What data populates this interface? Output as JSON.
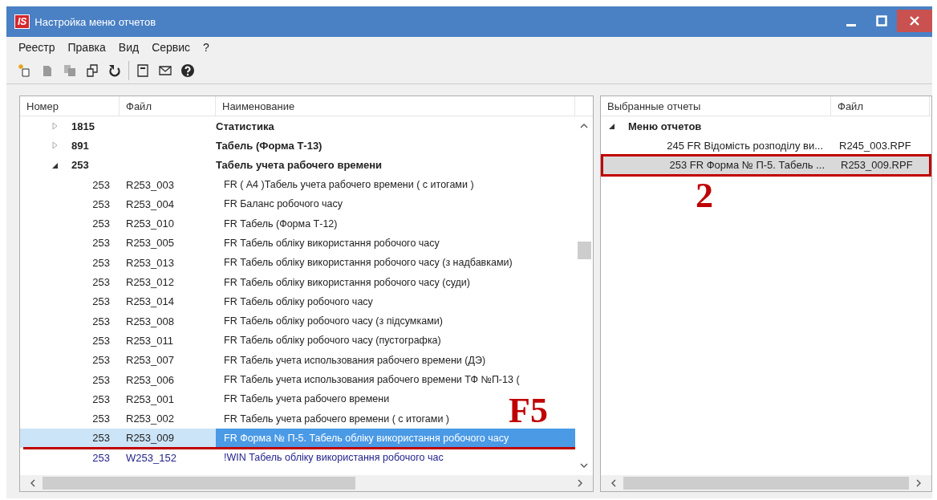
{
  "window": {
    "logo": "IS",
    "title": "Настройка меню отчетов"
  },
  "menu": [
    "Реестр",
    "Правка",
    "Вид",
    "Сервис",
    "?"
  ],
  "toolbar": [
    {
      "kind": "new",
      "disabled": false
    },
    {
      "kind": "page",
      "disabled": true
    },
    {
      "kind": "pages",
      "disabled": true
    },
    {
      "kind": "copy",
      "disabled": false
    },
    {
      "kind": "refresh",
      "disabled": false
    },
    {
      "kind": "separator"
    },
    {
      "kind": "form",
      "disabled": false
    },
    {
      "kind": "mail",
      "disabled": false
    },
    {
      "kind": "help",
      "disabled": false
    }
  ],
  "report_tree": {
    "columns": [
      "Номер",
      "Файл",
      "Наименование"
    ],
    "groups": [
      {
        "number": "1815",
        "name": "Статистика",
        "expanded": false,
        "selected": false
      },
      {
        "number": "891",
        "name": "Табель (Форма Т-13)",
        "expanded": false,
        "selected": false
      },
      {
        "number": "253",
        "name": "Табель учета рабочего времени",
        "expanded": true,
        "selected": false,
        "children": [
          {
            "number": "253",
            "file": "R253_003",
            "name": "FR ( А4 )Табель учета рабочего времени ( с итогами )",
            "kind": "report",
            "selected": false
          },
          {
            "number": "253",
            "file": "R253_004",
            "name": "FR Баланс робочого часу",
            "kind": "report",
            "selected": false
          },
          {
            "number": "253",
            "file": "R253_010",
            "name": "FR Табель (Форма Т-12)",
            "kind": "report",
            "selected": false
          },
          {
            "number": "253",
            "file": "R253_005",
            "name": "FR Табель обліку використання робочого часу",
            "kind": "report",
            "selected": false
          },
          {
            "number": "253",
            "file": "R253_013",
            "name": "FR Табель обліку використання робочого часу (з надбавками)",
            "kind": "report",
            "selected": false
          },
          {
            "number": "253",
            "file": "R253_012",
            "name": "FR Табель обліку використання робочого часу (суди)",
            "kind": "report",
            "selected": false
          },
          {
            "number": "253",
            "file": "R253_014",
            "name": "FR Табель обліку робочого часу",
            "kind": "report",
            "selected": false
          },
          {
            "number": "253",
            "file": "R253_008",
            "name": "FR Табель обліку робочого часу (з підсумками)",
            "kind": "report",
            "selected": false
          },
          {
            "number": "253",
            "file": "R253_011",
            "name": "FR Табель обліку робочого часу (пустографка)",
            "kind": "report",
            "selected": false
          },
          {
            "number": "253",
            "file": "R253_007",
            "name": "FR Табель учета использования рабочего времени (ДЭ)",
            "kind": "report",
            "selected": false
          },
          {
            "number": "253",
            "file": "R253_006",
            "name": "FR Табель учета использования рабочего времени ТФ №П-13 (",
            "kind": "report",
            "selected": false
          },
          {
            "number": "253",
            "file": "R253_001",
            "name": "FR Табель учета рабочего времени",
            "kind": "report",
            "selected": false
          },
          {
            "number": "253",
            "file": "R253_002",
            "name": "FR Табель учета рабочего времени ( с итогами )",
            "kind": "report",
            "selected": false
          },
          {
            "number": "253",
            "file": "R253_009",
            "name": "FR Форма № П-5. Табель обліку використання робочого часу",
            "kind": "report",
            "selected": true,
            "callout": "F5"
          },
          {
            "number": "253",
            "file": "W253_152",
            "name": "!WIN Табель обліку використання робочого час",
            "kind": "win",
            "selected": false
          }
        ]
      }
    ]
  },
  "selected_tree": {
    "columns": [
      "Выбранные отчеты",
      "Файл"
    ],
    "root": {
      "name": "Меню отчетов",
      "expanded": true,
      "children": [
        {
          "name": "245 FR Відомість розподілу ви...",
          "file": "R245_003.RPF",
          "selected": false
        },
        {
          "name": "253 FR Форма № П-5. Табель ...",
          "file": "R253_009.RPF",
          "selected": true,
          "callout": "2"
        }
      ]
    }
  }
}
